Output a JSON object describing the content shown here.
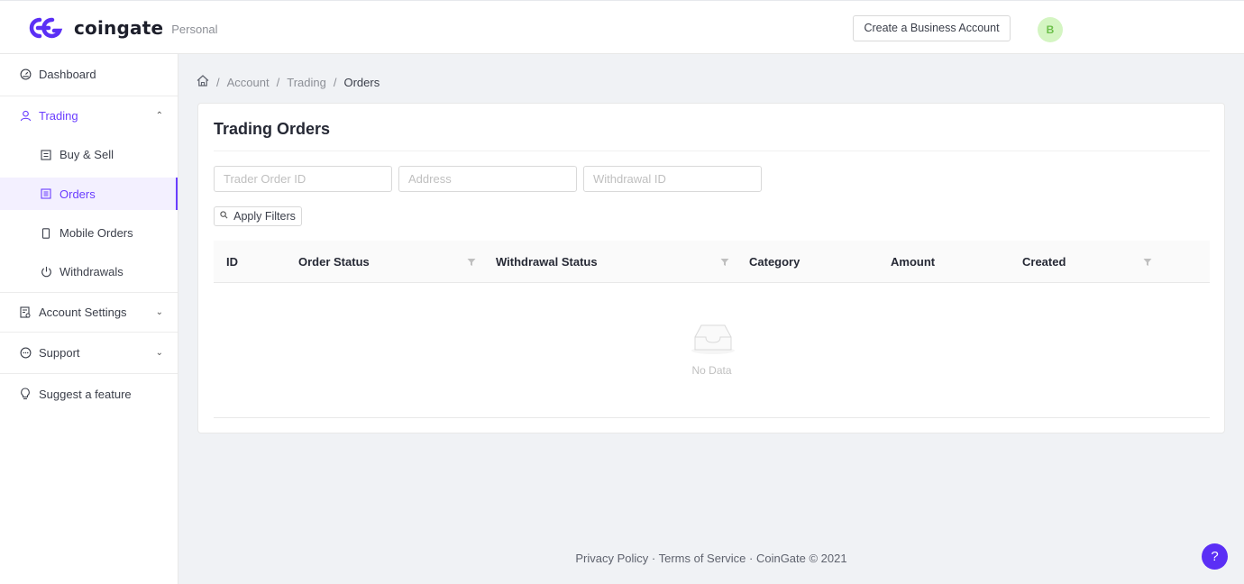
{
  "header": {
    "brand": "coingate",
    "account_type": "Personal",
    "business_button": "Create a Business Account",
    "avatar_initial": "B",
    "brand_color": "#5b2ff5"
  },
  "sidebar": {
    "dashboard": "Dashboard",
    "trading": "Trading",
    "buy_sell": "Buy & Sell",
    "orders": "Orders",
    "mobile_orders": "Mobile Orders",
    "withdrawals": "Withdrawals",
    "account_settings": "Account Settings",
    "support": "Support",
    "suggest": "Suggest a feature"
  },
  "breadcrumb": {
    "account": "Account",
    "trading": "Trading",
    "orders": "Orders"
  },
  "card": {
    "title": "Trading Orders",
    "filters": {
      "trader_order_id": "Trader Order ID",
      "address": "Address",
      "withdrawal_id": "Withdrawal ID"
    },
    "apply_button": "Apply Filters",
    "columns": {
      "id": "ID",
      "order_status": "Order Status",
      "withdrawal_status": "Withdrawal Status",
      "category": "Category",
      "amount": "Amount",
      "created": "Created"
    },
    "empty_text": "No Data"
  },
  "footer": {
    "text": "Privacy Policy · Terms of Service · CoinGate © 2021"
  }
}
